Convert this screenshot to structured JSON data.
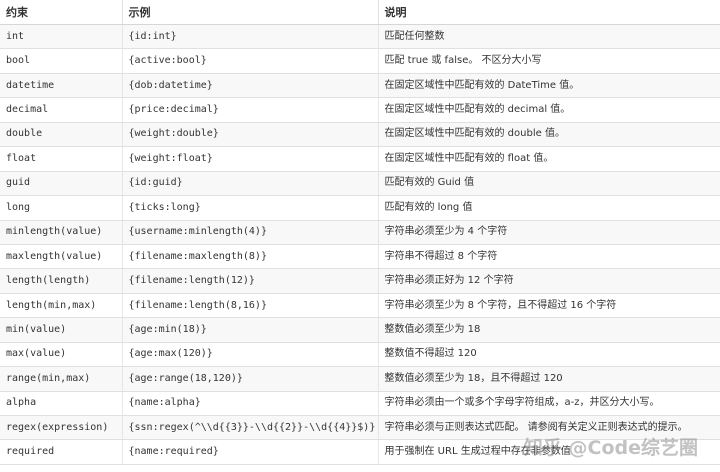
{
  "table": {
    "headers": [
      "约束",
      "示例",
      "说明"
    ],
    "rows": [
      {
        "constraint": "int",
        "example": "{id:int}",
        "description": "匹配任何整数"
      },
      {
        "constraint": "bool",
        "example": "{active:bool}",
        "description": "匹配 true 或 false。 不区分大小写"
      },
      {
        "constraint": "datetime",
        "example": "{dob:datetime}",
        "description": "在固定区域性中匹配有效的 DateTime 值。"
      },
      {
        "constraint": "decimal",
        "example": "{price:decimal}",
        "description": "在固定区域性中匹配有效的 decimal 值。"
      },
      {
        "constraint": "double",
        "example": "{weight:double}",
        "description": "在固定区域性中匹配有效的 double 值。"
      },
      {
        "constraint": "float",
        "example": "{weight:float}",
        "description": "在固定区域性中匹配有效的 float 值。"
      },
      {
        "constraint": "guid",
        "example": "{id:guid}",
        "description": "匹配有效的 Guid 值"
      },
      {
        "constraint": "long",
        "example": "{ticks:long}",
        "description": "匹配有效的 long 值"
      },
      {
        "constraint": "minlength(value)",
        "example": "{username:minlength(4)}",
        "description": "字符串必须至少为 4 个字符"
      },
      {
        "constraint": "maxlength(value)",
        "example": "{filename:maxlength(8)}",
        "description": "字符串不得超过 8 个字符"
      },
      {
        "constraint": "length(length)",
        "example": "{filename:length(12)}",
        "description": "字符串必须正好为 12 个字符"
      },
      {
        "constraint": "length(min,max)",
        "example": "{filename:length(8,16)}",
        "description": "字符串必须至少为 8 个字符，且不得超过 16 个字符"
      },
      {
        "constraint": "min(value)",
        "example": "{age:min(18)}",
        "description": "整数值必须至少为 18"
      },
      {
        "constraint": "max(value)",
        "example": "{age:max(120)}",
        "description": "整数值不得超过 120"
      },
      {
        "constraint": "range(min,max)",
        "example": "{age:range(18,120)}",
        "description": "整数值必须至少为 18，且不得超过 120"
      },
      {
        "constraint": "alpha",
        "example": "{name:alpha}",
        "description": "字符串必须由一个或多个字母字符组成，a-z，并区分大小写。"
      },
      {
        "constraint": "regex(expression)",
        "example": "{ssn:regex(^\\\\d{{3}}-\\\\d{{2}}-\\\\d{{4}}$)}",
        "description": "字符串必须与正则表达式匹配。 请参阅有关定义正则表达式的提示。"
      },
      {
        "constraint": "required",
        "example": "{name:required}",
        "description": "用于强制在 URL 生成过程中存在非参数值"
      }
    ]
  },
  "watermark": {
    "text": "知乎 @Code综艺圈"
  }
}
